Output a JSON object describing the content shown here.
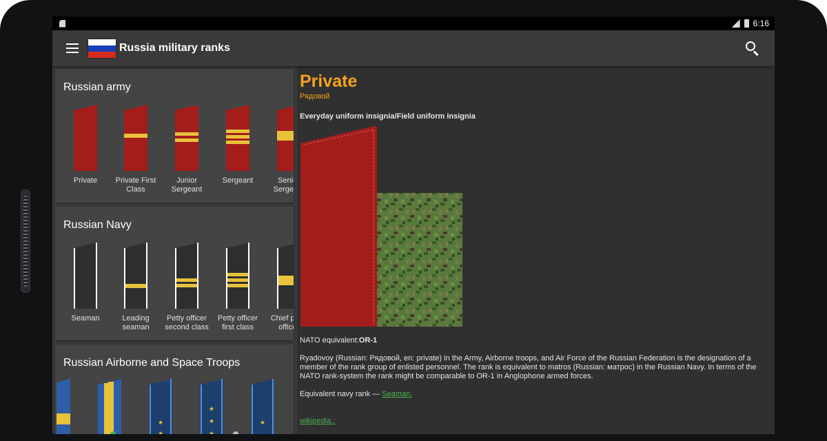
{
  "status_bar": {
    "time": "6:16"
  },
  "app": {
    "title": "Russia military ranks",
    "flag_colors": [
      "#ffffff",
      "#1c3fb8",
      "#d52b1e"
    ]
  },
  "sections": [
    {
      "title": "Russian army",
      "ranks": [
        {
          "label": "Private",
          "stripes": 0
        },
        {
          "label": "Private First Class",
          "stripes": 1
        },
        {
          "label": "Junior Sergeant",
          "stripes": 2
        },
        {
          "label": "Sergeant",
          "stripes": 3
        },
        {
          "label": "Senior Sergeant",
          "stripes": 1
        }
      ]
    },
    {
      "title": "Russian Navy",
      "ranks": [
        {
          "label": "Seaman",
          "stripes": 0
        },
        {
          "label": "Leading seaman",
          "stripes": 1
        },
        {
          "label": "Petty officer second class",
          "stripes": 2
        },
        {
          "label": "Petty officer first class",
          "stripes": 3
        },
        {
          "label": "Chief petty officer",
          "stripes": 1
        }
      ]
    },
    {
      "title": "Russian Airborne and Space Troops",
      "ranks": []
    }
  ],
  "detail": {
    "title": "Private",
    "subtitle": "Рядовой",
    "caption": "Everyday uniform insignia/Field uniform insignia",
    "nato_label": "NATO equivalent:",
    "nato_value": "OR-1",
    "description": "Ryadovoy (Russian: Рядовой, en: private) in the Army, Airborne troops, and Air Force of the Russian Federation is the designation of a member of the rank group of enlisted personnel. The rank is equivalent to matros (Russian: матрос) in the Russian Navy. In terms of the NATO rank-system the rank might be comparable to OR-1 in Anglophone armed forces.",
    "navy_label": "Equivalent navy rank — ",
    "navy_link": "Seaman.",
    "wiki_link": "wikipedia.."
  },
  "colors": {
    "accent": "#f6a21e",
    "link": "#4caf50",
    "shoulder_red": "#a31d1b",
    "stripe_gold": "#e8c23a",
    "airborne_blue": "#2f5ea8"
  }
}
